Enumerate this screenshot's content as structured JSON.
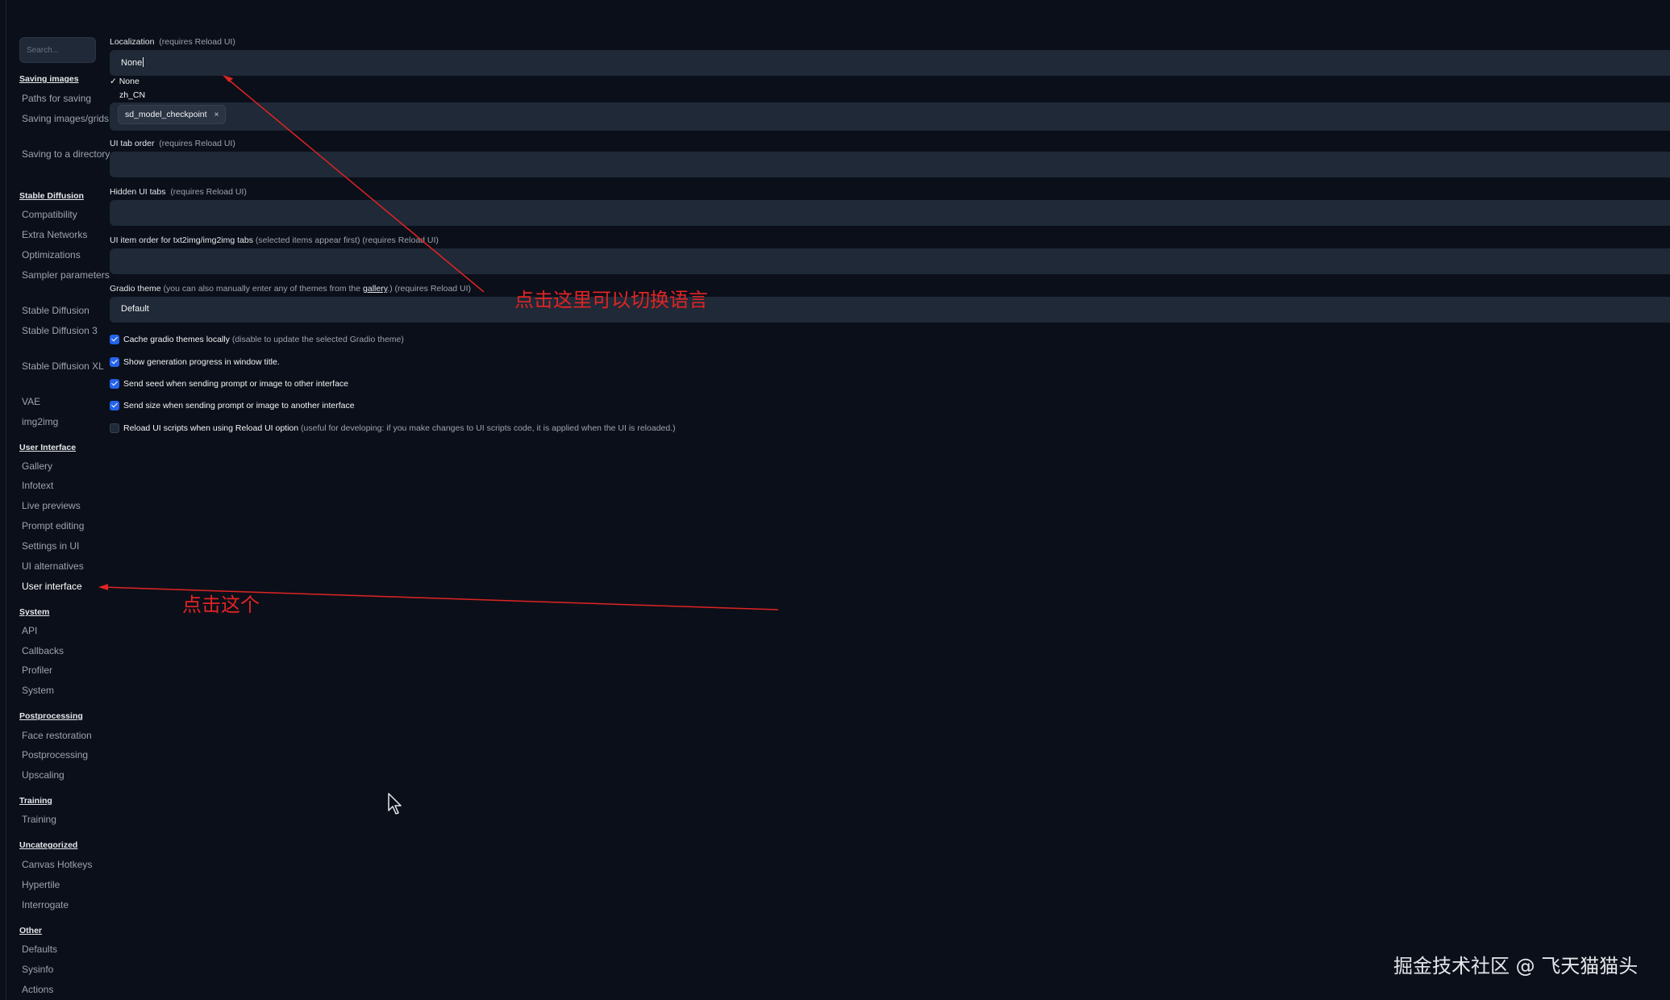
{
  "search": {
    "placeholder": "Search..."
  },
  "sidebar": {
    "sections": [
      {
        "title": "Saving images",
        "items": [
          "Paths for saving",
          "Saving images/grids",
          "Saving to a directory"
        ]
      },
      {
        "title": "Stable Diffusion",
        "items": [
          "Compatibility",
          "Extra Networks",
          "Optimizations",
          "Sampler parameters",
          "Stable Diffusion",
          "Stable Diffusion 3",
          "Stable Diffusion XL",
          "VAE",
          "img2img"
        ]
      },
      {
        "title": "User Interface",
        "items": [
          "Gallery",
          "Infotext",
          "Live previews",
          "Prompt editing",
          "Settings in UI",
          "UI alternatives",
          "User interface"
        ]
      },
      {
        "title": "System",
        "items": [
          "API",
          "Callbacks",
          "Profiler",
          "System"
        ]
      },
      {
        "title": "Postprocessing",
        "items": [
          "Face restoration",
          "Postprocessing",
          "Upscaling"
        ]
      },
      {
        "title": "Training",
        "items": [
          "Training"
        ]
      },
      {
        "title": "Uncategorized",
        "items": [
          "Canvas Hotkeys",
          "Hypertile",
          "Interrogate"
        ]
      },
      {
        "title": "Other",
        "items": [
          "Defaults",
          "Sysinfo",
          "Actions"
        ]
      }
    ]
  },
  "settings": {
    "localization": {
      "label": "Localization",
      "hint": "(requires Reload UI)",
      "value": "None",
      "options": [
        "✓ None",
        "zh_CN"
      ],
      "chip": "sd_model_checkpoint",
      "chip_close": "×"
    },
    "tab_order": {
      "label": "UI tab order",
      "hint": "(requires Reload UI)"
    },
    "hidden_tabs": {
      "label": "Hidden UI tabs",
      "hint": "(requires Reload UI)"
    },
    "item_order": {
      "label": "UI item order for txt2img/img2img tabs",
      "hint": "(selected items appear first) (requires Reload UI)"
    },
    "gradio_theme": {
      "label": "Gradio theme",
      "hint_before": "(you can also manually enter any of themes from the",
      "link": "gallery",
      "hint_after": ".) (requires Reload UI)",
      "value": "Default"
    },
    "checkboxes": [
      {
        "label": "Cache gradio themes locally",
        "hint": "(disable to update the selected Gradio theme)",
        "checked": true
      },
      {
        "label": "Show generation progress in window title.",
        "hint": "",
        "checked": true
      },
      {
        "label": "Send seed when sending prompt or image to other interface",
        "hint": "",
        "checked": true
      },
      {
        "label": "Send size when sending prompt or image to another interface",
        "hint": "",
        "checked": true
      },
      {
        "label": "Reload UI scripts when using Reload UI option",
        "hint": "(useful for developing: if you make changes to UI scripts code, it is applied when the UI is reloaded.)",
        "checked": false
      }
    ]
  },
  "annotations": {
    "switch_language": "点击这里可以切换语言",
    "click_this": "点击这个",
    "color": "#e02424"
  },
  "watermark": "掘金技术社区 @ 飞天猫猫头",
  "colors": {
    "background": "#0b0f19",
    "field": "#1f2937",
    "accent": "#2563eb"
  }
}
